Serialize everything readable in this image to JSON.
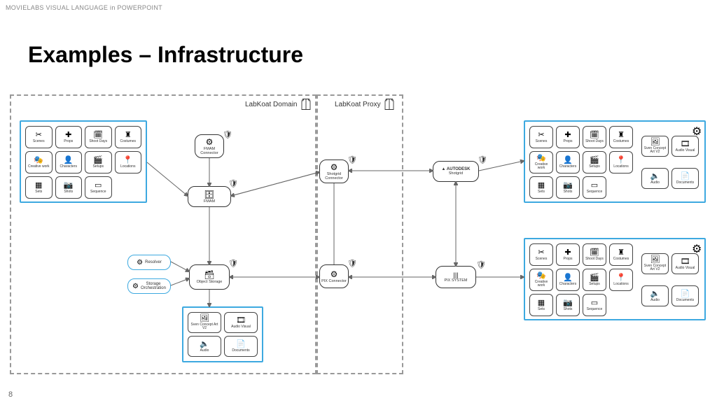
{
  "header": "MOVIELABS VISUAL LANGUAGE in POWERPOINT",
  "title": "Examples – Infrastructure",
  "page_number": "8",
  "regions": {
    "domain": "LabKoat Domain",
    "proxy": "LabKoat Proxy"
  },
  "asset_categories": [
    {
      "label": "Scenes",
      "glyph": "✂"
    },
    {
      "label": "Props",
      "glyph": "✚"
    },
    {
      "label": "Shoot Days",
      "glyph": "🗓"
    },
    {
      "label": "Costumes",
      "glyph": "♜"
    },
    {
      "label": "Creative work",
      "glyph": "🎭"
    },
    {
      "label": "Characters",
      "glyph": "👤"
    },
    {
      "label": "Setups",
      "glyph": "🎬"
    },
    {
      "label": "Locations",
      "glyph": "📍"
    },
    {
      "label": "Sets",
      "glyph": "▦"
    },
    {
      "label": "Shots",
      "glyph": "📷"
    },
    {
      "label": "Sequence",
      "glyph": "▭"
    }
  ],
  "media_tiles": [
    {
      "label": "Sven Concept Art V2",
      "glyph": "🖼"
    },
    {
      "label": "Audio Visual",
      "glyph": "🎞"
    },
    {
      "label": "Audio",
      "glyph": "🔈"
    },
    {
      "label": "Documents",
      "glyph": "📄"
    }
  ],
  "nodes": {
    "fmam_connector": "FMAM Connector",
    "fmam": "FMAM",
    "shotgrid_connector": "Shotgrid Connector",
    "shotgrid": "Shotgrid",
    "autodesk": "▲ AUTODESK",
    "object_storage": "Object Storage",
    "pix_connector": "PIX Connector",
    "pix": "PIX SYSTEM",
    "resolver": "Resolver",
    "storage_orch": "Storage Orchestration"
  }
}
